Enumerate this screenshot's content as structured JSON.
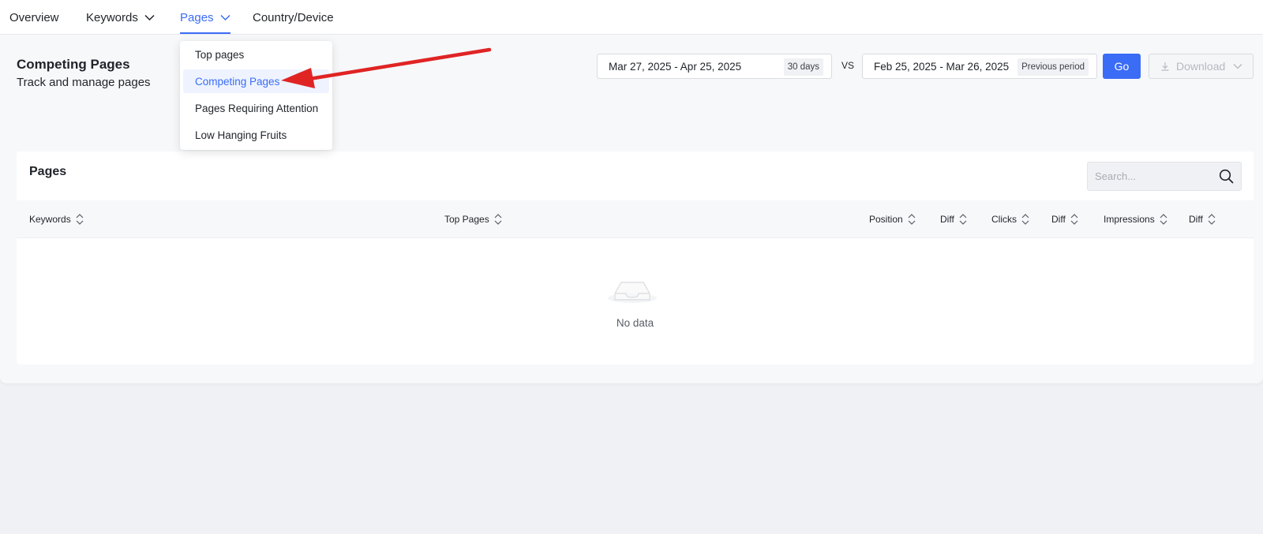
{
  "nav": {
    "items": [
      {
        "label": "Overview",
        "has_dropdown": false,
        "active": false
      },
      {
        "label": "Keywords",
        "has_dropdown": true,
        "active": false
      },
      {
        "label": "Pages",
        "has_dropdown": true,
        "active": true
      },
      {
        "label": "Country/Device",
        "has_dropdown": false,
        "active": false
      }
    ]
  },
  "header": {
    "title": "Competing Pages",
    "subtitle": "Track and manage pages"
  },
  "date_range": {
    "current": "Mar 27, 2025 - Apr 25, 2025",
    "current_tag": "30 days",
    "vs_label": "VS",
    "compare": "Feb 25, 2025 - Mar 26, 2025",
    "compare_tag": "Previous period",
    "go_label": "Go",
    "download_label": "Download"
  },
  "dropdown": {
    "items": [
      {
        "label": "Top pages",
        "selected": false
      },
      {
        "label": "Competing Pages",
        "selected": true
      },
      {
        "label": "Pages Requiring Attention",
        "selected": false
      },
      {
        "label": "Low Hanging Fruits",
        "selected": false
      }
    ]
  },
  "table": {
    "title": "Pages",
    "search_placeholder": "Search...",
    "columns": [
      "Keywords",
      "Top Pages",
      "Position",
      "Diff",
      "Clicks",
      "Diff",
      "Impressions",
      "Diff"
    ],
    "rows": [],
    "empty_text": "No data"
  },
  "colors": {
    "accent": "#3b6cf6",
    "annotation_arrow": "#e02424"
  }
}
